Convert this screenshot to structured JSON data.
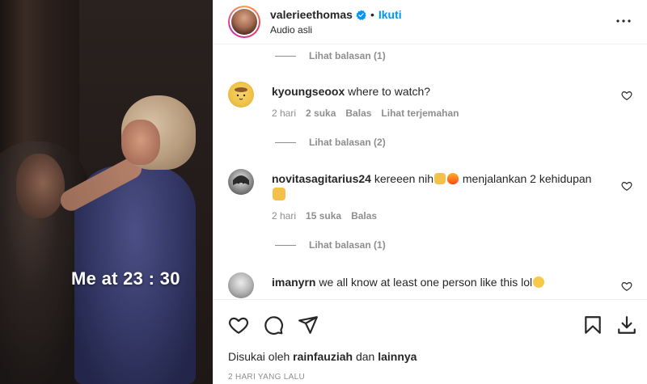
{
  "video": {
    "caption": "Me at 23 : 30"
  },
  "header": {
    "username": "valerieethomas",
    "separator": "•",
    "follow_label": "Ikuti",
    "audio": "Audio asli"
  },
  "comments": [
    {
      "view_replies_top": "Lihat balasan (1)"
    },
    {
      "username": "kyoungseoox",
      "text": "where to watch?",
      "time": "2 hari",
      "likes": "2 suka",
      "reply": "Balas",
      "translate": "Lihat terjemahan",
      "view_replies": "Lihat balasan (2)"
    },
    {
      "username": "novitasagitarius24",
      "text_a": "kereeen nih",
      "text_b": "menjalankan 2 kehidupan",
      "time": "2 hari",
      "likes": "15 suka",
      "reply": "Balas",
      "view_replies": "Lihat balasan (1)"
    },
    {
      "username": "imanyrn",
      "text": "we all know at least one person like this lol"
    }
  ],
  "footer": {
    "liked_prefix": "Disukai oleh",
    "liked_user": "rainfauziah",
    "liked_and": "dan",
    "liked_others": "lainnya",
    "date": "2 HARI YANG LALU"
  },
  "colors": {
    "accent": "#0095f6",
    "muted": "#8e8e8e",
    "text": "#262626"
  }
}
